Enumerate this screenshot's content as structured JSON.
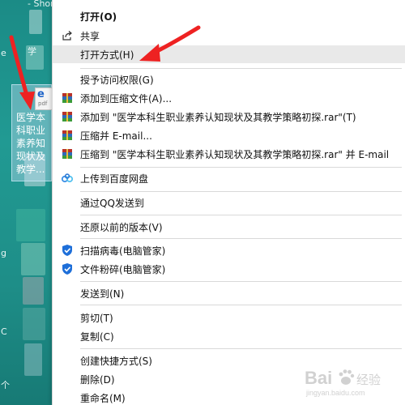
{
  "desktop": {
    "top_label": "- Shortcut    提升.rtf",
    "edge_texts": [
      "e",
      "学",
      "g",
      "C",
      "个"
    ],
    "file": {
      "icon_letter": "e",
      "icon_caption": "pdf",
      "name": "医学本科职业素养知现状及教学..."
    }
  },
  "context_menu": {
    "items": [
      {
        "id": "open",
        "label": "打开(O)"
      },
      {
        "id": "share",
        "label": "共享"
      },
      {
        "id": "open-with",
        "label": "打开方式(H)"
      },
      {
        "id": "grant-access",
        "label": "授予访问权限(G)"
      },
      {
        "id": "add-to-archive",
        "label": "添加到压缩文件(A)..."
      },
      {
        "id": "add-to-rar",
        "label": "添加到 \"医学本科生职业素养认知现状及其教学策略初探.rar\"(T)"
      },
      {
        "id": "compress-email",
        "label": "压缩并 E-mail..."
      },
      {
        "id": "compress-rar-email",
        "label": "压缩到 \"医学本科生职业素养认知现状及其教学策略初探.rar\" 并 E-mail"
      },
      {
        "id": "upload-baidu",
        "label": "上传到百度网盘"
      },
      {
        "id": "send-qq",
        "label": "通过QQ发送到"
      },
      {
        "id": "restore-version",
        "label": "还原以前的版本(V)"
      },
      {
        "id": "scan-virus",
        "label": "扫描病毒(电脑管家)"
      },
      {
        "id": "shred-file",
        "label": "文件粉碎(电脑管家)"
      },
      {
        "id": "send-to",
        "label": "发送到(N)"
      },
      {
        "id": "cut",
        "label": "剪切(T)"
      },
      {
        "id": "copy",
        "label": "复制(C)"
      },
      {
        "id": "create-shortcut",
        "label": "创建快捷方式(S)"
      },
      {
        "id": "delete",
        "label": "删除(D)"
      },
      {
        "id": "rename",
        "label": "重命名(M)"
      }
    ]
  },
  "watermark": {
    "text": "Bai",
    "suffix": "经验",
    "sub": "jingyan.baidu.com"
  },
  "colors": {
    "desktop": "#1f8f8a",
    "menu_bg": "#ffffff",
    "highlight": "#e9e9e9",
    "annotation_arrow": "#ee2222",
    "shield": "#1e6fd9"
  },
  "icons": {
    "share": "share-icon",
    "winrar": "winrar-icon",
    "baidu": "baidu-netdisk-icon",
    "guard": "tencent-pc-manager-icon"
  }
}
